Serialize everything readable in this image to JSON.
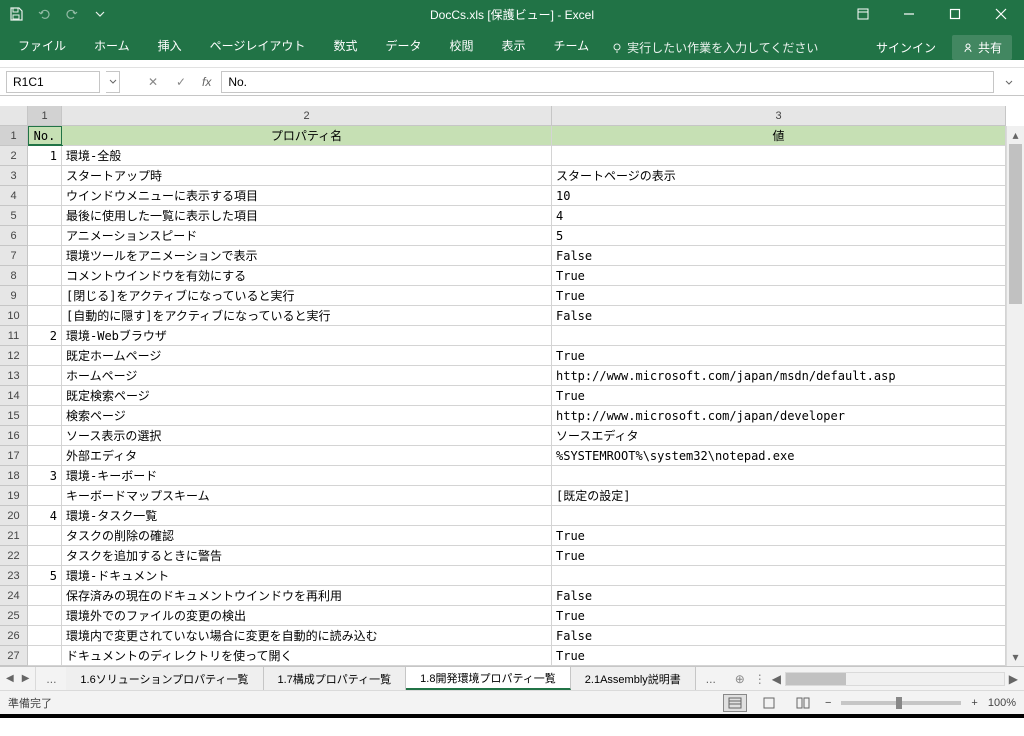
{
  "title": "DocCs.xls [保護ビュー] - Excel",
  "qat": {
    "save": "保存"
  },
  "tabs": [
    "ファイル",
    "ホーム",
    "挿入",
    "ページレイアウト",
    "数式",
    "データ",
    "校閲",
    "表示",
    "チーム"
  ],
  "tellme": "実行したい作業を入力してください",
  "signin": "サインイン",
  "share": "共有",
  "namebox": "R1C1",
  "formula": "No.",
  "col_headers": [
    "1",
    "2",
    "3"
  ],
  "row_headers": [
    "1",
    "2",
    "3",
    "4",
    "5",
    "6",
    "7",
    "8",
    "9",
    "10",
    "11",
    "12",
    "13",
    "14",
    "15",
    "16",
    "17",
    "18",
    "19",
    "20",
    "21",
    "22",
    "23",
    "24",
    "25",
    "26",
    "27"
  ],
  "header": {
    "c1": "No.",
    "c2": "プロパティ名",
    "c3": "値"
  },
  "rows": [
    {
      "no": "1",
      "name": "環境-全般",
      "val": ""
    },
    {
      "no": "",
      "name": "スタートアップ時",
      "val": "スタートページの表示"
    },
    {
      "no": "",
      "name": "ウインドウメニューに表示する項目",
      "val": "10"
    },
    {
      "no": "",
      "name": "最後に使用した一覧に表示した項目",
      "val": "4"
    },
    {
      "no": "",
      "name": "アニメーションスピード",
      "val": "5"
    },
    {
      "no": "",
      "name": "環境ツールをアニメーションで表示",
      "val": "False"
    },
    {
      "no": "",
      "name": "コメントウインドウを有効にする",
      "val": "True"
    },
    {
      "no": "",
      "name": "[閉じる]をアクティブになっていると実行",
      "val": "True"
    },
    {
      "no": "",
      "name": "[自動的に隠す]をアクティブになっていると実行",
      "val": "False"
    },
    {
      "no": "2",
      "name": "環境-Webブラウザ",
      "val": ""
    },
    {
      "no": "",
      "name": "既定ホームページ",
      "val": "True"
    },
    {
      "no": "",
      "name": "ホームページ",
      "val": "http://www.microsoft.com/japan/msdn/default.asp"
    },
    {
      "no": "",
      "name": "既定検索ページ",
      "val": "True"
    },
    {
      "no": "",
      "name": "検索ページ",
      "val": "http://www.microsoft.com/japan/developer"
    },
    {
      "no": "",
      "name": "ソース表示の選択",
      "val": "ソースエディタ"
    },
    {
      "no": "",
      "name": "外部エディタ",
      "val": "%SYSTEMROOT%\\system32\\notepad.exe"
    },
    {
      "no": "3",
      "name": "環境-キーボード",
      "val": ""
    },
    {
      "no": "",
      "name": "キーボードマップスキーム",
      "val": "[既定の設定]"
    },
    {
      "no": "4",
      "name": "環境-タスク一覧",
      "val": ""
    },
    {
      "no": "",
      "name": "タスクの削除の確認",
      "val": "True"
    },
    {
      "no": "",
      "name": "タスクを追加するときに警告",
      "val": "True"
    },
    {
      "no": "5",
      "name": "環境-ドキュメント",
      "val": ""
    },
    {
      "no": "",
      "name": "保存済みの現在のドキュメントウインドウを再利用",
      "val": "False"
    },
    {
      "no": "",
      "name": "環境外でのファイルの変更の検出",
      "val": "True"
    },
    {
      "no": "",
      "name": "環境内で変更されていない場合に変更を自動的に読み込む",
      "val": "False"
    },
    {
      "no": "",
      "name": "ドキュメントのディレクトリを使って開く",
      "val": "True"
    }
  ],
  "sheets": [
    "1.6ソリューションプロパティ一覧",
    "1.7構成プロパティ一覧",
    "1.8開発環境プロパティ一覧",
    "2.1Assembly説明書"
  ],
  "active_sheet": 2,
  "status": "準備完了",
  "zoom": "100%",
  "chart_data": {
    "type": "table",
    "title": "1.8開発環境プロパティ一覧",
    "columns": [
      "No.",
      "プロパティ名",
      "値"
    ]
  }
}
